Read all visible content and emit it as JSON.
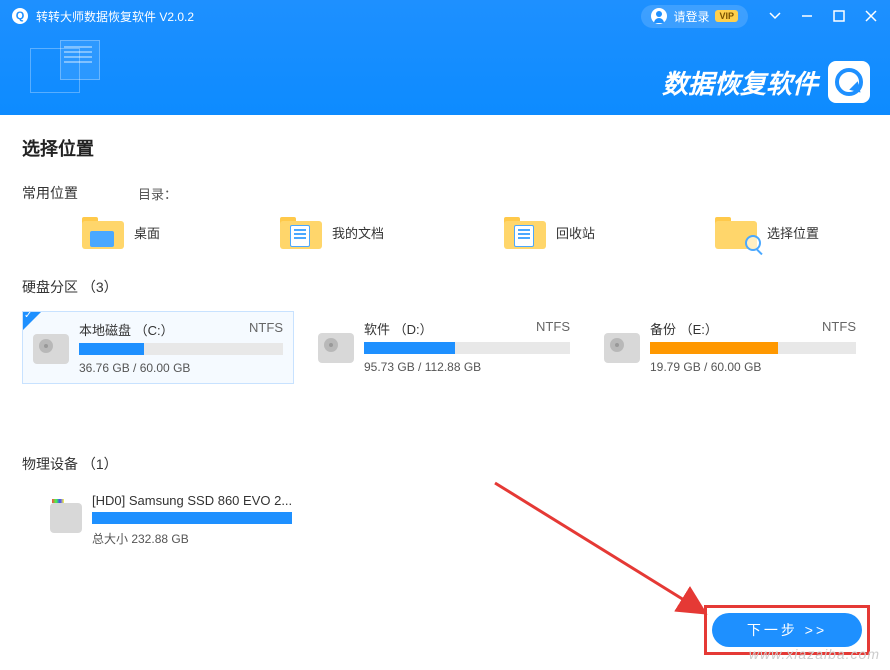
{
  "titlebar": {
    "app_title": "转转大师数据恢复软件 V2.0.2",
    "login_text": "请登录",
    "vip_badge": "VIP"
  },
  "header": {
    "brand_text": "数据恢复软件"
  },
  "page": {
    "title": "选择位置"
  },
  "common_locations": {
    "section_label": "常用位置",
    "dir_label": "目录：",
    "items": [
      {
        "label": "桌面"
      },
      {
        "label": "我的文档"
      },
      {
        "label": "回收站"
      },
      {
        "label": "选择位置"
      }
    ]
  },
  "partitions": {
    "section_title": "硬盘分区 （3）",
    "items": [
      {
        "name": "本地磁盘 （C:）",
        "fs": "NTFS",
        "usage": "36.76 GB / 60.00 GB",
        "fill_percent": 32,
        "color": "blue",
        "selected": true
      },
      {
        "name": "软件 （D:）",
        "fs": "NTFS",
        "usage": "95.73 GB / 112.88 GB",
        "fill_percent": 44,
        "color": "blue",
        "selected": false
      },
      {
        "name": "备份 （E:）",
        "fs": "NTFS",
        "usage": "19.79 GB / 60.00 GB",
        "fill_percent": 62,
        "color": "orange",
        "selected": false
      }
    ]
  },
  "devices": {
    "section_title": "物理设备 （1）",
    "items": [
      {
        "name": "[HD0] Samsung SSD 860 EVO 2...",
        "size_label": "总大小 232.88 GB"
      }
    ]
  },
  "footer": {
    "next_label": "下一步 >>"
  },
  "watermark": "www.xiazaiba.com"
}
